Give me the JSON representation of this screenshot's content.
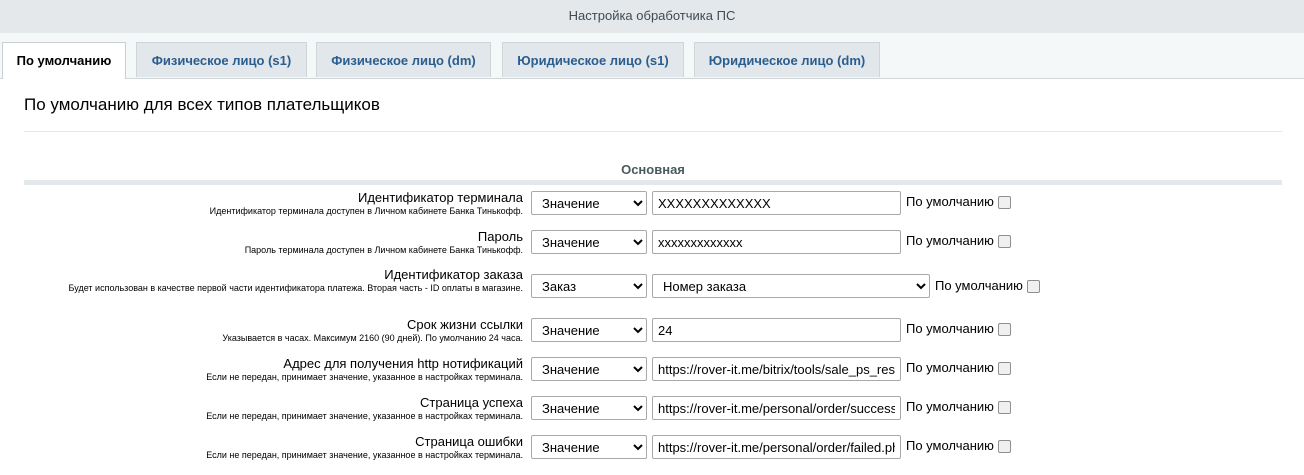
{
  "window": {
    "title": "Настройка обработчика ПС"
  },
  "tabs": [
    {
      "label": "По умолчанию",
      "active": true
    },
    {
      "label": "Физическое лицо (s1)"
    },
    {
      "label": "Физическое лицо (dm)"
    },
    {
      "label": "Юридическое лицо (s1)"
    },
    {
      "label": "Юридическое лицо (dm)"
    }
  ],
  "page": {
    "heading": "По умолчанию для всех типов плательщиков",
    "section": "Основная",
    "default_label": "По умолчанию"
  },
  "fields": [
    {
      "label": "Идентификатор терминала",
      "hint": "Идентификатор терминала доступен в Личном кабинете Банка Тинькофф.",
      "type": "Значение",
      "value": "XXXXXXXXXXXXX"
    },
    {
      "label": "Пароль",
      "hint": "Пароль терминала доступен в Личном кабинете Банка Тинькофф.",
      "type": "Значение",
      "value": "xxxxxxxxxxxxx"
    },
    {
      "label": "Идентификатор заказа",
      "hint": "Будет использован в качестве первой части идентификатора платежа. Вторая часть - ID оплаты в магазине.",
      "type": "Заказ",
      "value": "Номер заказа"
    },
    {
      "label": "Срок жизни ссылки",
      "hint": "Указывается в часах. Максимум 2160 (90 дней). По умолчанию 24 часа.",
      "type": "Значение",
      "value": "24"
    },
    {
      "label": "Адрес для получения http нотификаций",
      "hint": "Если не передан, принимает значение, указанное в настройках терминала.",
      "type": "Значение",
      "value": "https://rover-it.me/bitrix/tools/sale_ps_result.php"
    },
    {
      "label": "Страница успеха",
      "hint": "Если не передан, принимает значение, указанное в настройках терминала.",
      "type": "Значение",
      "value": "https://rover-it.me/personal/order/success.php"
    },
    {
      "label": "Страница ошибки",
      "hint": "Если не передан, принимает значение, указанное в настройках терминала.",
      "type": "Значение",
      "value": "https://rover-it.me/personal/order/failed.php"
    }
  ]
}
